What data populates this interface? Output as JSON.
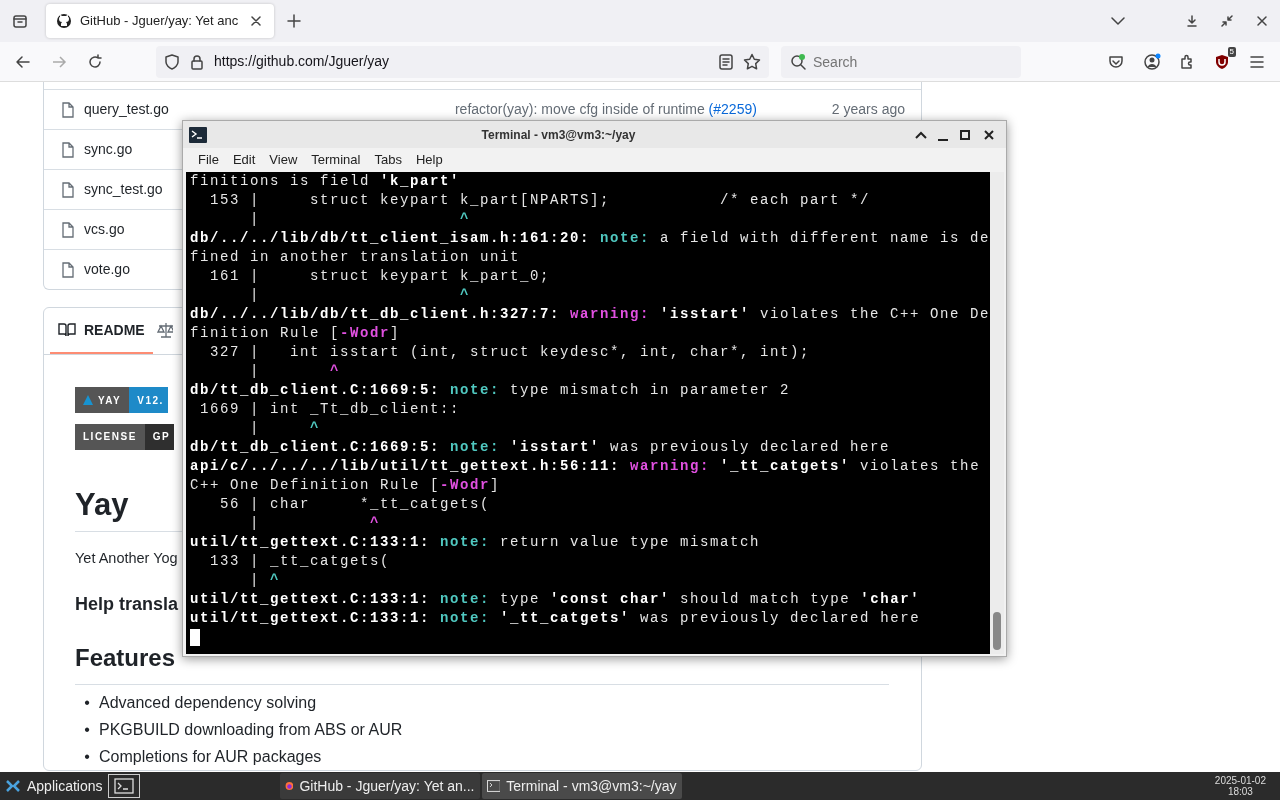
{
  "browser": {
    "tab": {
      "title": "GitHub - Jguer/yay: Yet anc",
      "selected": true
    },
    "url": "https://github.com/Jguer/yay",
    "search": {
      "placeholder": "Search"
    },
    "addon_badge": "5"
  },
  "files": [
    {
      "name": "query_test.go",
      "commit": "refactor(yay): move cfg inside of runtime ",
      "commit_link": "(#2259)",
      "age": "2 years ago"
    },
    {
      "name": "sync.go"
    },
    {
      "name": "sync_test.go"
    },
    {
      "name": "vcs.go"
    },
    {
      "name": "vote.go"
    }
  ],
  "readme": {
    "tabs": [
      {
        "label": "README",
        "selected": true
      },
      {
        "selected": false
      }
    ],
    "badges": [
      {
        "label": "YAY",
        "value": "V12.",
        "color": "#1e8ac8"
      },
      {
        "label": "LICENSE",
        "value": "GP",
        "color": "#2f2f2f"
      }
    ],
    "title": "Yay",
    "intro": "Yet Another Yog",
    "help_heading": "Help transla",
    "features_heading": "Features",
    "features": [
      {
        "marker": "•",
        "text": "Advanced dependency solving"
      },
      {
        "marker": "•",
        "text": "PKGBUILD downloading from ABS or AUR"
      },
      {
        "marker": "•",
        "text": "Completions for AUR packages"
      }
    ]
  },
  "terminal": {
    "title": "Terminal - vm3@vm3:~/yay",
    "menu": [
      "File",
      "Edit",
      "View",
      "Terminal",
      "Tabs",
      "Help"
    ],
    "lines": [
      [
        {
          "text": "finitions is field ",
          "kind": "plain"
        },
        {
          "text": "'k_part'",
          "kind": "bold"
        }
      ],
      [
        {
          "text": "  153 |     struct keypart k_part[NPARTS];           /* each part */",
          "kind": "plain"
        }
      ],
      [
        {
          "text": "      |                    ",
          "kind": "plain"
        },
        {
          "text": "^",
          "kind": "note"
        }
      ],
      [
        {
          "text": "db/../../lib/db/tt_client_isam.h:161:20: ",
          "kind": "bold"
        },
        {
          "text": "note:",
          "kind": "note"
        },
        {
          "text": " a field with different name is de",
          "kind": "plain"
        }
      ],
      [
        {
          "text": "fined in another translation unit",
          "kind": "plain"
        }
      ],
      [
        {
          "text": "  161 |     struct keypart k_part_0;",
          "kind": "plain"
        }
      ],
      [
        {
          "text": "      |                    ",
          "kind": "plain"
        },
        {
          "text": "^",
          "kind": "note"
        }
      ],
      [
        {
          "text": "db/../../lib/db/tt_db_client.h:327:7: ",
          "kind": "bold"
        },
        {
          "text": "warning: ",
          "kind": "warning"
        },
        {
          "text": "'isstart'",
          "kind": "bold"
        },
        {
          "text": " violates the C++ One De",
          "kind": "plain"
        }
      ],
      [
        {
          "text": "finition Rule [",
          "kind": "plain"
        },
        {
          "text": "-Wodr",
          "kind": "warning"
        },
        {
          "text": "]",
          "kind": "plain"
        }
      ],
      [
        {
          "text": "  327 |   int isstart (int, struct keydesc*, int, char*, int);",
          "kind": "plain"
        }
      ],
      [
        {
          "text": "      |       ",
          "kind": "plain"
        },
        {
          "text": "^",
          "kind": "warning"
        }
      ],
      [
        {
          "text": "db/tt_db_client.C:1669:5: ",
          "kind": "bold"
        },
        {
          "text": "note:",
          "kind": "note"
        },
        {
          "text": " type mismatch in parameter 2",
          "kind": "plain"
        }
      ],
      [
        {
          "text": " 1669 | int _Tt_db_client::",
          "kind": "plain"
        }
      ],
      [
        {
          "text": "      |     ",
          "kind": "plain"
        },
        {
          "text": "^",
          "kind": "note"
        }
      ],
      [
        {
          "text": "db/tt_db_client.C:1669:5: ",
          "kind": "bold"
        },
        {
          "text": "note: ",
          "kind": "note"
        },
        {
          "text": "'isstart'",
          "kind": "bold"
        },
        {
          "text": " was previously declared here",
          "kind": "plain"
        }
      ],
      [
        {
          "text": "api/c/../../../lib/util/tt_gettext.h:56:11: ",
          "kind": "bold"
        },
        {
          "text": "warning: ",
          "kind": "warning"
        },
        {
          "text": "'_tt_catgets'",
          "kind": "bold"
        },
        {
          "text": " violates the",
          "kind": "plain"
        }
      ],
      [
        {
          "text": "C++ One Definition Rule [",
          "kind": "plain"
        },
        {
          "text": "-Wodr",
          "kind": "warning"
        },
        {
          "text": "]",
          "kind": "plain"
        }
      ],
      [
        {
          "text": "   56 | char     *_tt_catgets(",
          "kind": "plain"
        }
      ],
      [
        {
          "text": "      |           ",
          "kind": "plain"
        },
        {
          "text": "^",
          "kind": "warning"
        }
      ],
      [
        {
          "text": "util/tt_gettext.C:133:1: ",
          "kind": "bold"
        },
        {
          "text": "note:",
          "kind": "note"
        },
        {
          "text": " return value type mismatch",
          "kind": "plain"
        }
      ],
      [
        {
          "text": "  133 | _tt_catgets(",
          "kind": "plain"
        }
      ],
      [
        {
          "text": "      | ",
          "kind": "plain"
        },
        {
          "text": "^",
          "kind": "note"
        }
      ],
      [
        {
          "text": "util/tt_gettext.C:133:1: ",
          "kind": "bold"
        },
        {
          "text": "note:",
          "kind": "note"
        },
        {
          "text": " type ",
          "kind": "plain"
        },
        {
          "text": "'const char'",
          "kind": "bold"
        },
        {
          "text": " should match type ",
          "kind": "plain"
        },
        {
          "text": "'char'",
          "kind": "bold"
        }
      ],
      [
        {
          "text": "util/tt_gettext.C:133:1: ",
          "kind": "bold"
        },
        {
          "text": "note: ",
          "kind": "note"
        },
        {
          "text": "'_tt_catgets'",
          "kind": "bold"
        },
        {
          "text": " was previously declared here",
          "kind": "plain"
        }
      ]
    ]
  },
  "taskbar": {
    "start": "Applications",
    "windows": [
      {
        "title": "GitHub - Jguer/yay: Yet an...",
        "selected": false
      },
      {
        "title": "Terminal - vm3@vm3:~/yay",
        "selected": true
      }
    ],
    "date": "2025-01-02",
    "time": "18:03"
  }
}
